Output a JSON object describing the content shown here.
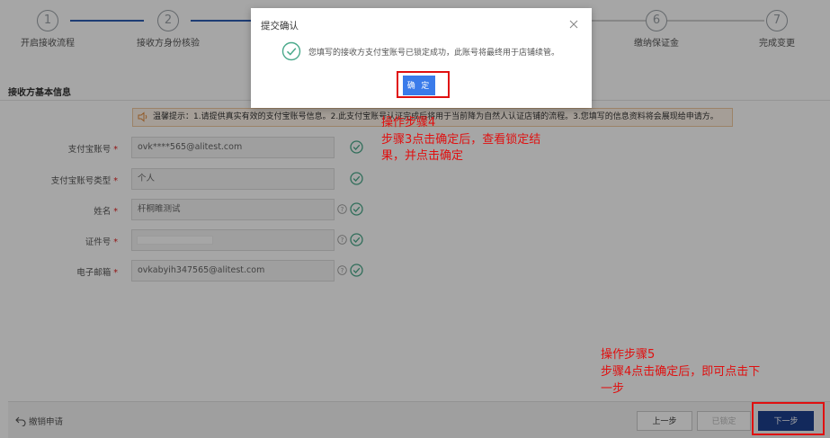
{
  "steps": [
    {
      "num": "1",
      "label": "开启接收流程"
    },
    {
      "num": "2",
      "label": "接收方身份核验"
    },
    {
      "num": "6",
      "label": "缴纳保证金"
    },
    {
      "num": "7",
      "label": "完成变更"
    }
  ],
  "section_title": "接收方基本信息",
  "tip_text": "温馨提示：1.请提供真实有效的支付宝账号信息。2.此支付宝账号认证完成后将用于当前降为自然人认证店铺的流程。3.您填写的信息资料将会展现给申请方。",
  "form": [
    {
      "label": "支付宝账号",
      "required": "*",
      "value": ""
    },
    {
      "label": "支付宝账号类型",
      "required": "*",
      "value": "个人"
    },
    {
      "label": "姓名",
      "required": "*",
      "value": "杆桐睢测试"
    },
    {
      "label": "证件号",
      "required": "*",
      "value": ""
    },
    {
      "label": "电子邮箱",
      "required": "*",
      "value": "ovkabyih347565@alitest.com"
    }
  ],
  "alipay_account_value": "ovk****565@alitest.com",
  "modal": {
    "title": "提交确认",
    "message": "您填写的接收方支付宝账号已锁定成功，此账号将最终用于店铺续管。",
    "confirm_label": "确 定"
  },
  "annotations": {
    "step4_title": "操作步骤4",
    "step4_line1": "步骤3点击确定后，查看锁定结",
    "step4_line2": "果，并点击确定",
    "step5_title": "操作步骤5",
    "step5_line1": "步骤4点击确定后，即可点击下",
    "step5_line2": "一步"
  },
  "footer": {
    "withdraw_label": "撤销申请",
    "prev_label": "上一步",
    "locked_label": "已锁定",
    "next_label": "下一步"
  },
  "colors": {
    "primary": "#3a7bea",
    "next_button": "#1c3f8e",
    "annotation_red": "#e01010",
    "check_green": "#4aa98b"
  }
}
